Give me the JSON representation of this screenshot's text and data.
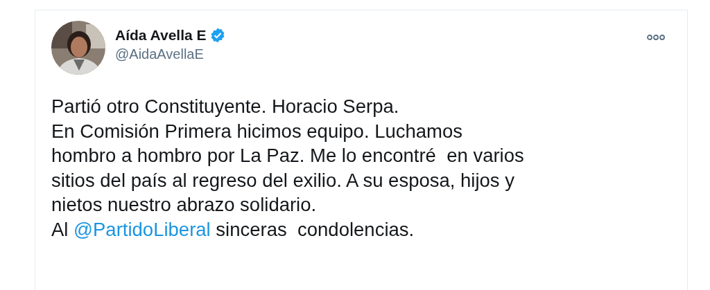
{
  "tweet": {
    "author": {
      "name": "Aída Avella E",
      "verified": true,
      "handle": "@AidaAvellaE"
    },
    "body": [
      {
        "lines": [
          "Partió otro Constituyente. Horacio Serpa.",
          "En Comisión Primera hicimos equipo. Luchamos",
          "hombro a hombro por La Paz. Me lo encontré  en varios",
          "sitios del país al regreso del exilio. A su esposa, hijos y",
          "nietos nuestro abrazo solidario."
        ]
      },
      {
        "before": "Al ",
        "mention": "@PartidoLiberal",
        "after": " sinceras  condolencias."
      }
    ]
  }
}
